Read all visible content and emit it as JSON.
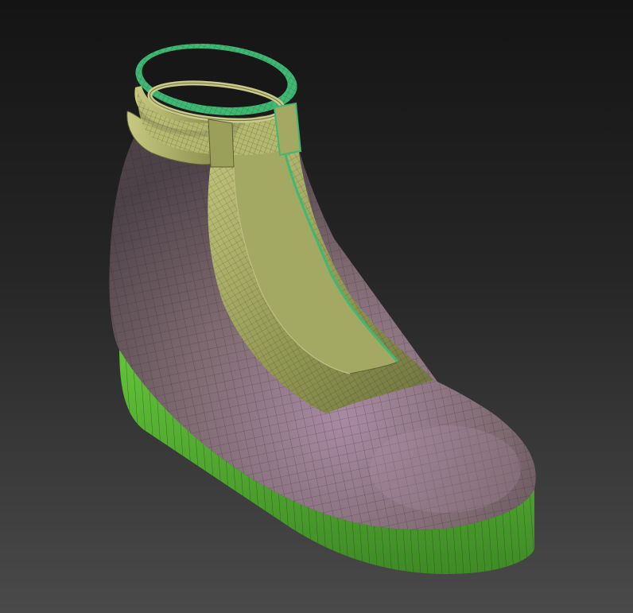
{
  "viewport": {
    "background_top": "#141414",
    "background_bottom": "#4a4a4a"
  },
  "model": {
    "subject": "boot",
    "display_mode": "shaded-wireframe",
    "colors": {
      "upper": "#7e6a70",
      "upper_highlight": "#a98aa4",
      "tongue_panel": "#8f9650",
      "tongue_highlight": "#c3c57c",
      "collar": "#a6aa5c",
      "sole": "#4fa52f",
      "sole_highlight": "#63c53a",
      "edge_trim": "#3fb873",
      "wire": "#1e1a1c"
    }
  }
}
